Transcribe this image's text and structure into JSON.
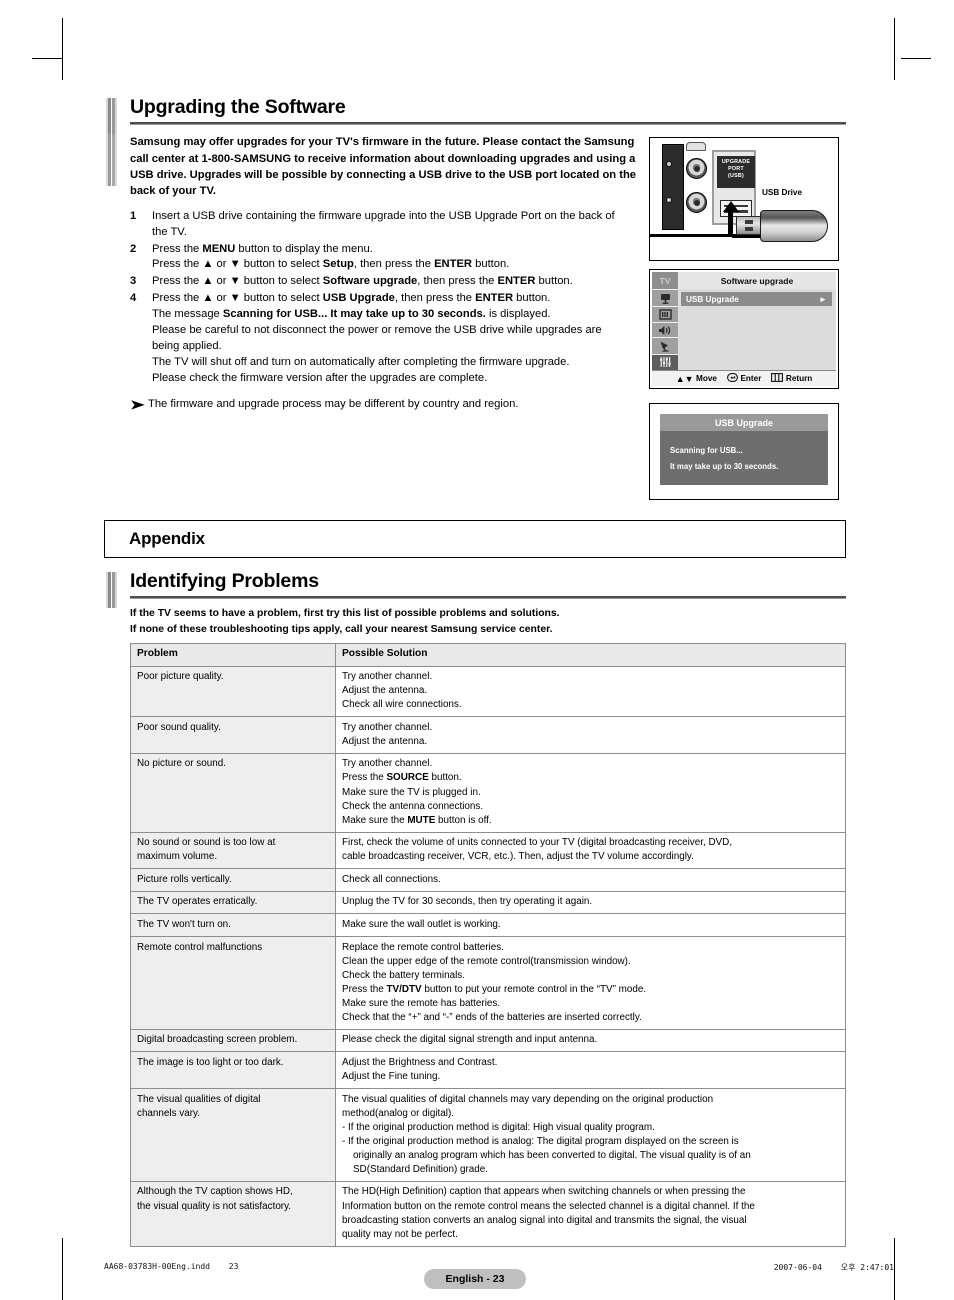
{
  "document": {
    "page_label": "English - 23",
    "footer_left_file": "AA68-03783H-00Eng.indd",
    "footer_left_page": "23",
    "footer_right_date": "2007-06-04",
    "footer_right_time": "오후 2:47:01"
  },
  "software_section": {
    "title": "Upgrading the Software",
    "intro": "Samsung may offer upgrades for your TV's firmware in the future. Please contact the Samsung call center at 1-800-SAMSUNG to receive information about downloading upgrades and using a USB drive. Upgrades will be possible by connecting a USB drive to the USB port located on the back of your TV.",
    "steps": [
      {
        "num": "1",
        "lines": [
          [
            {
              "t": "Insert a USB drive containing the firmware upgrade into the USB Upgrade Port on the back of"
            }
          ],
          [
            {
              "t": "the TV."
            }
          ]
        ]
      },
      {
        "num": "2",
        "lines": [
          [
            {
              "t": "Press the "
            },
            {
              "t": "MENU",
              "b": true
            },
            {
              "t": " button to display the menu."
            }
          ],
          [
            {
              "t": "Press the ▲ or ▼ button to select "
            },
            {
              "t": "Setup",
              "b": true
            },
            {
              "t": ", then press the "
            },
            {
              "t": "ENTER",
              "b": true
            },
            {
              "t": " button."
            }
          ]
        ]
      },
      {
        "num": "3",
        "lines": [
          [
            {
              "t": "Press the ▲ or ▼ button to select "
            },
            {
              "t": "Software upgrade",
              "b": true
            },
            {
              "t": ", then press the "
            },
            {
              "t": "ENTER",
              "b": true
            },
            {
              "t": " button."
            }
          ]
        ]
      },
      {
        "num": "4",
        "lines": [
          [
            {
              "t": "Press the ▲ or ▼ button to select "
            },
            {
              "t": "USB Upgrade",
              "b": true
            },
            {
              "t": ", then press the "
            },
            {
              "t": "ENTER",
              "b": true
            },
            {
              "t": " button."
            }
          ],
          [
            {
              "t": "The message "
            },
            {
              "t": "Scanning for USB... It may take up to 30 seconds.",
              "b": true
            },
            {
              "t": " is displayed."
            }
          ],
          [
            {
              "t": "Please be careful to not disconnect the power or remove the USB drive while upgrades are"
            }
          ],
          [
            {
              "t": "being applied."
            }
          ],
          [
            {
              "t": "The TV will shut off and turn on automatically after completing the firmware upgrade."
            }
          ],
          [
            {
              "t": "Please check the firmware version after the upgrades are complete."
            }
          ]
        ]
      }
    ],
    "note_mark": "➤",
    "note": "The firmware and upgrade process may be different by country and region."
  },
  "figures": {
    "usb_connection": {
      "port_label_line1": "UPGRADE",
      "port_label_line2": "PORT",
      "port_label_line3": "(USB)",
      "drive_caption": "USB Drive"
    },
    "osd_menu": {
      "sidebar_tv": "TV",
      "title": "Software upgrade",
      "selected_item": "USB Upgrade",
      "arrow_glyph": "►",
      "footer": [
        {
          "icon": "↕",
          "label": "Move"
        },
        {
          "icon": "↵",
          "label": "Enter"
        },
        {
          "icon": "⌸",
          "label": "Return"
        }
      ],
      "icons": [
        "input-icon",
        "picture-icon",
        "sound-icon",
        "channel-icon",
        "setup-icon"
      ]
    },
    "usb_popup": {
      "title": "USB Upgrade",
      "line1": "Scanning for USB...",
      "line2": "It may take up to 30 seconds."
    }
  },
  "appendix": {
    "title": "Appendix"
  },
  "problems_section": {
    "title": "Identifying Problems",
    "intro_line1": "If the TV seems to have a problem, first try this list of possible problems and solutions.",
    "intro_line2": "If none of these troubleshooting tips apply, call your nearest Samsung service center.",
    "headers": {
      "problem": "Problem",
      "solution": "Possible Solution"
    },
    "rows": [
      {
        "problem": [
          "Poor picture quality."
        ],
        "solution": [
          [
            {
              "t": "Try another channel."
            }
          ],
          [
            {
              "t": "Adjust the antenna."
            }
          ],
          [
            {
              "t": "Check all wire connections."
            }
          ]
        ]
      },
      {
        "problem": [
          "Poor sound quality."
        ],
        "solution": [
          [
            {
              "t": "Try another channel."
            }
          ],
          [
            {
              "t": "Adjust the antenna."
            }
          ]
        ]
      },
      {
        "problem": [
          "No picture or sound."
        ],
        "solution": [
          [
            {
              "t": "Try another channel."
            }
          ],
          [
            {
              "t": "Press the "
            },
            {
              "t": "SOURCE",
              "b": true
            },
            {
              "t": " button."
            }
          ],
          [
            {
              "t": "Make sure the TV is plugged in."
            }
          ],
          [
            {
              "t": "Check the antenna connections."
            }
          ],
          [
            {
              "t": "Make sure the "
            },
            {
              "t": "MUTE",
              "b": true
            },
            {
              "t": " button is off."
            }
          ]
        ]
      },
      {
        "problem": [
          "No sound or sound is too low at",
          "maximum volume."
        ],
        "solution": [
          [
            {
              "t": "First, check the volume of units connected to your TV (digital broadcasting receiver, DVD,"
            }
          ],
          [
            {
              "t": "cable broadcasting receiver, VCR, etc.). Then, adjust the TV volume accordingly."
            }
          ]
        ]
      },
      {
        "problem": [
          "Picture rolls vertically."
        ],
        "solution": [
          [
            {
              "t": "Check all connections."
            }
          ]
        ]
      },
      {
        "problem": [
          "The TV operates erratically."
        ],
        "solution": [
          [
            {
              "t": "Unplug the TV for 30 seconds, then try operating it again."
            }
          ]
        ]
      },
      {
        "problem": [
          "The TV won't turn on."
        ],
        "solution": [
          [
            {
              "t": "Make sure the wall outlet is working."
            }
          ]
        ]
      },
      {
        "problem": [
          "Remote control malfunctions"
        ],
        "solution": [
          [
            {
              "t": "Replace the remote control batteries."
            }
          ],
          [
            {
              "t": "Clean the upper edge of the remote control(transmission window)."
            }
          ],
          [
            {
              "t": "Check the battery terminals."
            }
          ],
          [
            {
              "t": "Press the "
            },
            {
              "t": "TV/DTV",
              "b": true
            },
            {
              "t": " button to put your remote control in the “TV” mode."
            }
          ],
          [
            {
              "t": "Make sure the remote has batteries."
            }
          ],
          [
            {
              "t": "Check that the “+” and “-” ends of the batteries are inserted correctly."
            }
          ]
        ]
      },
      {
        "problem": [
          "Digital broadcasting screen problem."
        ],
        "solution": [
          [
            {
              "t": "Please check the digital signal strength and input antenna."
            }
          ]
        ]
      },
      {
        "problem": [
          "The image is too light or too dark."
        ],
        "solution": [
          [
            {
              "t": "Adjust the Brightness and Contrast."
            }
          ],
          [
            {
              "t": "Adjust the Fine tuning."
            }
          ]
        ]
      },
      {
        "problem": [
          "The visual qualities of digital",
          "channels vary."
        ],
        "solution": [
          [
            {
              "t": "The visual qualities of digital channels may vary depending on the original production"
            }
          ],
          [
            {
              "t": "method(analog or digital)."
            }
          ],
          [
            {
              "t": "-   If the original production method is digital: High visual quality program."
            }
          ],
          [
            {
              "t": "-   If the original production method is analog: The digital program displayed on the screen is"
            }
          ],
          [
            {
              "t": "    originally an analog program which has been converted to digital. The visual quality is of an"
            }
          ],
          [
            {
              "t": "    SD(Standard Definition) grade."
            }
          ]
        ]
      },
      {
        "problem": [
          "Although the TV caption shows HD,",
          "the visual quality is not satisfactory."
        ],
        "solution": [
          [
            {
              "t": "The HD(High Definition) caption that appears when switching channels or when pressing the"
            }
          ],
          [
            {
              "t": "Information button on the remote control means the selected channel is a digital channel. If the"
            }
          ],
          [
            {
              "t": "broadcasting station converts an analog signal into digital and transmits the signal, the visual"
            }
          ],
          [
            {
              "t": "quality may not be perfect."
            }
          ]
        ]
      }
    ]
  }
}
